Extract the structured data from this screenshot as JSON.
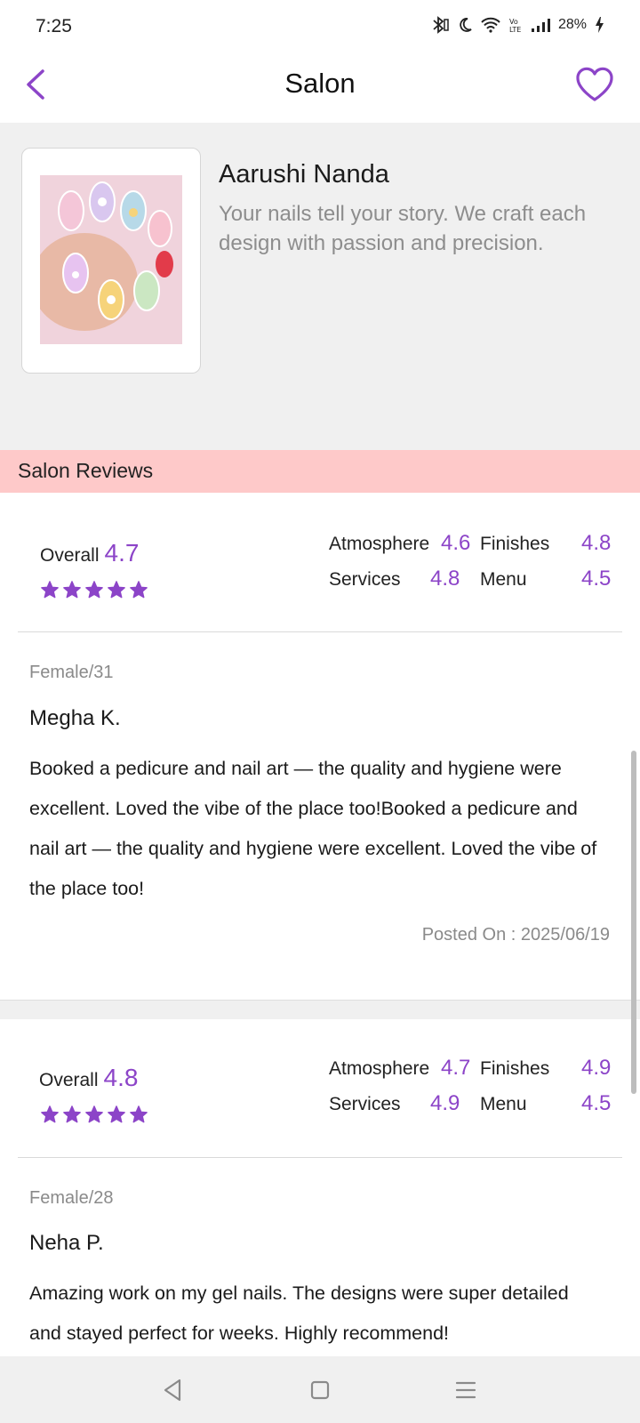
{
  "status_bar": {
    "time": "7:25",
    "battery": "28%"
  },
  "header": {
    "title": "Salon",
    "back_icon": "chevron-left-icon",
    "favorite_icon": "heart-outline-icon"
  },
  "salon": {
    "name": "Aarushi Nanda",
    "description": "Your nails tell your story. We craft each design with passion and precision."
  },
  "reviews_section": {
    "title": "Salon Reviews"
  },
  "reviews": [
    {
      "overall_label": "Overall",
      "overall_value": "4.7",
      "stars": 5,
      "atmosphere_label": "Atmosphere",
      "atmosphere_value": "4.6",
      "finishes_label": "Finishes",
      "finishes_value": "4.8",
      "services_label": "Services",
      "services_value": "4.8",
      "menu_label": "Menu",
      "menu_value": "4.5",
      "meta": "Female/31",
      "name": "Megha K.",
      "text": "Booked a pedicure and nail art — the quality and hygiene were excellent. Loved the vibe of the place too!Booked a pedicure and nail art — the quality and hygiene were excellent. Loved the vibe of the place too!",
      "posted_on": "Posted On : 2025/06/19"
    },
    {
      "overall_label": "Overall",
      "overall_value": "4.8",
      "stars": 5,
      "atmosphere_label": "Atmosphere",
      "atmosphere_value": "4.7",
      "finishes_label": "Finishes",
      "finishes_value": "4.9",
      "services_label": "Services",
      "services_value": "4.9",
      "menu_label": "Menu",
      "menu_value": "4.5",
      "meta": "Female/28",
      "name": "Neha P.",
      "text": "Amazing work on my gel nails. The designs were super detailed and stayed perfect for weeks. Highly recommend!"
    }
  ],
  "colors": {
    "accent": "#8c44c8",
    "reviews_band": "#fec9c9",
    "section_bg": "#f0f0f0"
  }
}
